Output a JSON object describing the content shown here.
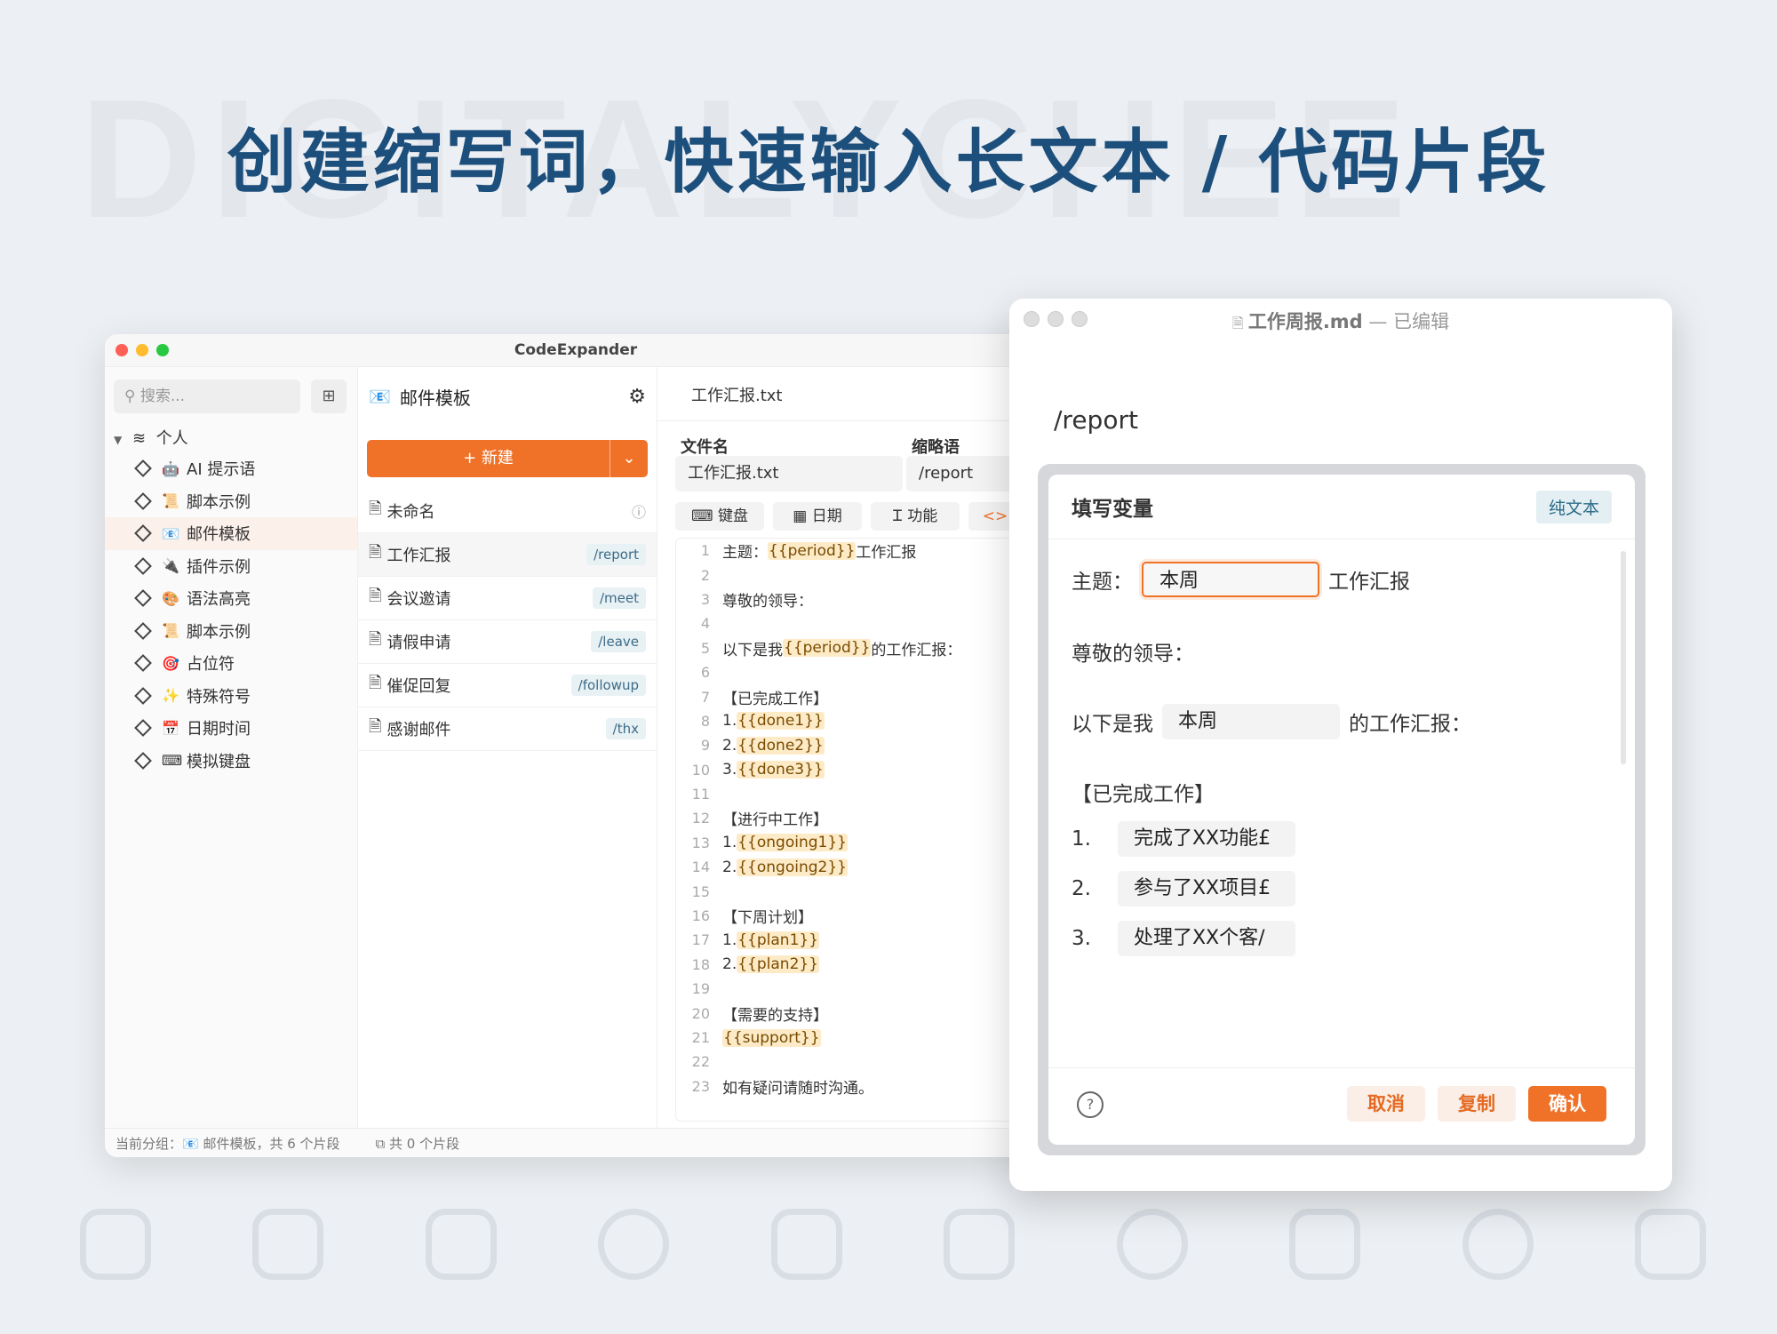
{
  "headline": "创建缩写词，快速输入长文本 / 代码片段",
  "watermark": "DIGITALYCHEE",
  "colors": {
    "accent": "#f07228",
    "headline": "#1d4f7c",
    "tag_bg": "#e8f1f4"
  },
  "main_window": {
    "title": "CodeExpander",
    "sidebar": {
      "search_placeholder": "搜索...",
      "root_label": "个人",
      "groups": [
        {
          "icon": "🤖",
          "label": "AI 提示语"
        },
        {
          "icon": "📜",
          "label": "脚本示例"
        },
        {
          "icon": "📧",
          "label": "邮件模板"
        },
        {
          "icon": "🔌",
          "label": "插件示例"
        },
        {
          "icon": "🎨",
          "label": "语法高亮"
        },
        {
          "icon": "📜",
          "label": "脚本示例"
        },
        {
          "icon": "🎯",
          "label": "占位符"
        },
        {
          "icon": "✨",
          "label": "特殊符号"
        },
        {
          "icon": "📅",
          "label": "日期时间"
        },
        {
          "icon": "⌨",
          "label": "模拟键盘"
        }
      ]
    },
    "list": {
      "group_title": "邮件模板",
      "new_label": "+  新建",
      "snippets": [
        {
          "name": "未命名",
          "abbr": ""
        },
        {
          "name": "工作汇报",
          "abbr": "/report"
        },
        {
          "name": "会议邀请",
          "abbr": "/meet"
        },
        {
          "name": "请假申请",
          "abbr": "/leave"
        },
        {
          "name": "催促回复",
          "abbr": "/followup"
        },
        {
          "name": "感谢邮件",
          "abbr": "/thx"
        }
      ]
    },
    "editor": {
      "tab_title": "工作汇报.txt",
      "filename_label": "文件名",
      "filename_value": "工作汇报.txt",
      "abbr_label": "缩略语",
      "abbr_value": "/report",
      "toolbar": {
        "keyboard": "键盘",
        "date": "日期",
        "function": "功能",
        "code": "<>"
      },
      "lines": [
        [
          "主题：",
          "{{period}}",
          "工作汇报"
        ],
        [
          ""
        ],
        [
          "尊敬的领导："
        ],
        [
          ""
        ],
        [
          "以下是我",
          "{{period}}",
          "的工作汇报："
        ],
        [
          ""
        ],
        [
          "【已完成工作】"
        ],
        [
          "1. ",
          "{{done1}}"
        ],
        [
          "2. ",
          "{{done2}}"
        ],
        [
          "3. ",
          "{{done3}}"
        ],
        [
          ""
        ],
        [
          "【进行中工作】"
        ],
        [
          "1. ",
          "{{ongoing1}}"
        ],
        [
          "2. ",
          "{{ongoing2}}"
        ],
        [
          ""
        ],
        [
          "【下周计划】"
        ],
        [
          "1. ",
          "{{plan1}}"
        ],
        [
          "2. ",
          "{{plan2}}"
        ],
        [
          ""
        ],
        [
          "【需要的支持】"
        ],
        [
          "",
          "{{support}}"
        ],
        [
          ""
        ],
        [
          "如有疑问请随时沟通。"
        ]
      ]
    },
    "status": {
      "left": "当前分组：📧 邮件模板，共 6 个片段",
      "right": "共 0 个片段"
    }
  },
  "doc_window": {
    "filename": "工作周报.md",
    "state": "— 已编辑",
    "typed": "/report",
    "dialog": {
      "title": "填写变量",
      "mode_badge": "纯文本",
      "subject_label": "主题：",
      "subject_value": "本周",
      "subject_suffix": "工作汇报",
      "greeting": "尊敬的领导：",
      "intro_prefix": "以下是我",
      "intro_value": "本周",
      "intro_suffix": "的工作汇报：",
      "section": "【已完成工作】",
      "items": [
        {
          "num": "1.",
          "value": "完成了XX功能£"
        },
        {
          "num": "2.",
          "value": "参与了XX项目£"
        },
        {
          "num": "3.",
          "value": "处理了XX个客/"
        }
      ],
      "cancel": "取消",
      "copy": "复制",
      "confirm": "确认"
    }
  }
}
